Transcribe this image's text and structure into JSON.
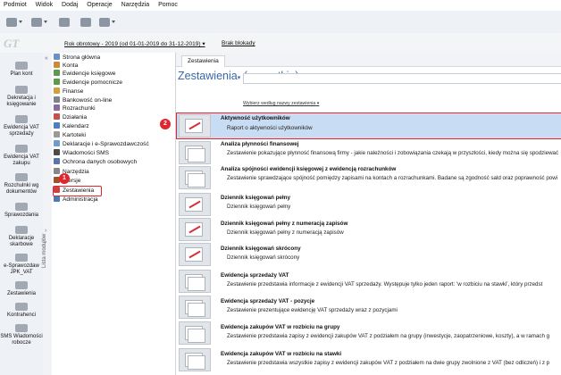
{
  "menu": [
    "Podmiot",
    "Widok",
    "Dodaj",
    "Operacje",
    "Narzędzia",
    "Pomoc"
  ],
  "header": {
    "year_label": "Rok obrotowy - 2019",
    "year_range": "(od 01-01-2019 do 31-12-2019)",
    "lock_label": "Brak blokady"
  },
  "left_nav": [
    "Plan kont",
    "Dekretacja i księgowanie",
    "Ewidencja VAT sprzedaży",
    "Ewidencja VAT zakupu",
    "Rozchulnki wg dokumentów",
    "Sprawozdania",
    "Deklaracje skarbowe",
    "e-Sprawozdaw JPK_VAT",
    "Zestawienia",
    "Kontrahenci",
    "SMS Wiadomości robocze"
  ],
  "lista_modulow": "Lista modułów",
  "tree": [
    "Strona główna",
    "Konta",
    "Ewidencje księgowe",
    "Ewidencje pomocnicze",
    "Finanse",
    "Bankowość on-line",
    "Rozrachunki",
    "Działania",
    "Kalendarz",
    "Kartoteki",
    "Deklaracje i e-Sprawozdawczość",
    "Wiadomości SMS",
    "Ochrona danych osobowych",
    "Narzędzia",
    "Wersje",
    "Zestawienia",
    "Administracja"
  ],
  "badges": {
    "one": "1",
    "two": "2"
  },
  "content": {
    "tab_label": "Zestawienia",
    "title": "Zestawienia",
    "filter": "(wszystkie)",
    "hint": "Wybierz według nazwy zestawienia"
  },
  "reports": [
    {
      "title": "Aktywność użytkowników",
      "desc": "Raport o aktywności użytkowników"
    },
    {
      "title": "Analiza płynności finansowej",
      "desc": "Zestawienie pokazujące płynność finansową firmy - jakie należności i zobowiązania czekają w przyszłości, kiedy można się spodziewać"
    },
    {
      "title": "Analiza spójności ewidencji księgowej z ewidencją rozrachunków",
      "desc": "Zestawienie sprawdzające spójność pomiędzy zapisami na kontach a rozrachunkami. Badane są zgodność sald oraz poprawność powi"
    },
    {
      "title": "Dziennik księgowań pełny",
      "desc": "Dziennik księgowań pełny"
    },
    {
      "title": "Dziennik księgowań pełny z numeracją zapisów",
      "desc": "Dziennik księgowań pełny z numeracją zapisów"
    },
    {
      "title": "Dziennik księgowań skrócony",
      "desc": "Dziennik księgowań skrócony"
    },
    {
      "title": "Ewidencja sprzedaży VAT",
      "desc": "Zestawienie przedstawia informacje z ewidencji VAT sprzedaży. Występuje tylko jeden raport: 'w rozbiciu na stawki', który przedst"
    },
    {
      "title": "Ewidencja sprzedaży VAT - pozycje",
      "desc": "Zestawienie prezentujące ewidencję VAT sprzedaży wraz z pozycjami"
    },
    {
      "title": "Ewidencja zakupów VAT w rozbiciu na grupy",
      "desc": "Zestawienie przedstawia zapisy z ewidencji zakupów VAT z podziałem na grupy (inwestycje, zaopatrzeniowe, koszty), a w ramach g"
    },
    {
      "title": "Ewidencja zakupów VAT w rozbiciu na stawki",
      "desc": "Zestawienie przedstawia wszystkie zapisy z ewidencji zakupów VAT z podziałem na dwie grupy zwolnione z VAT (bez odliczeń) i z p"
    }
  ]
}
